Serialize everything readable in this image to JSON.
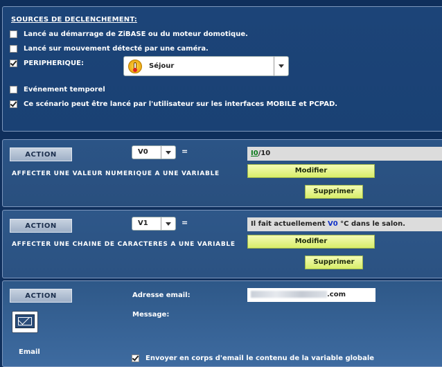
{
  "sources": {
    "title": "SOURCES DE DECLENCHEMENT:",
    "opt1": "Lancé au démarrage de ZiBASE ou du moteur domotique.",
    "opt2": "Lancé sur mouvement détecté par une caméra.",
    "opt3": "PERIPHERIQUE:",
    "device_selected": "Séjour",
    "opt4": "Evénement temporel",
    "opt5": "Ce scénario peut être lancé par l'utilisateur sur les interfaces MOBILE et PCPAD."
  },
  "action1": {
    "button": "ACTION",
    "variable": "V0",
    "equals": "=",
    "value_var": "I0",
    "value_rest": "/10",
    "description": "AFFECTER UNE VALEUR NUMERIQUE A UNE VARIABLE",
    "modify": "Modifier",
    "delete": "Supprimer"
  },
  "action2": {
    "button": "ACTION",
    "variable": "V1",
    "equals": "=",
    "text_before": "Il fait actuellement ",
    "text_var": "V0",
    "text_after": " °C dans le salon.",
    "description": "AFFECTER UNE CHAINE DE CARACTERES A UNE VARIABLE",
    "modify": "Modifier",
    "delete": "Supprimer"
  },
  "action3": {
    "button": "ACTION",
    "email_icon_label": "Email",
    "address_label": "Adresse email:",
    "address_suffix": ".com",
    "message_label": "Message:",
    "checkbox_label": "Envoyer en corps d'email le contenu de la variable globale"
  }
}
